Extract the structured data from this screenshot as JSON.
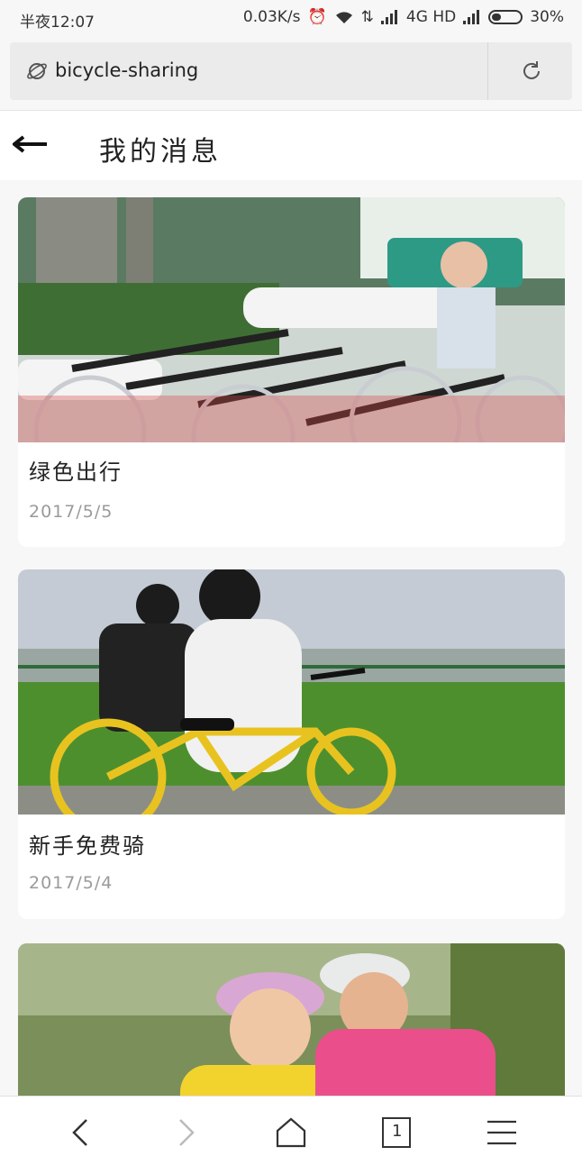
{
  "status_bar": {
    "time": "半夜12:07",
    "network_speed": "0.03K/s",
    "network_type": "4G HD",
    "battery": "30%"
  },
  "browser": {
    "url": "bicycle-sharing"
  },
  "header": {
    "title": "我的消息"
  },
  "messages": [
    {
      "title": "绿色出行",
      "date": "2017/5/5",
      "image": "bike-station-photo"
    },
    {
      "title": "新手免费骑",
      "date": "2017/5/4",
      "image": "couple-riding-photo"
    },
    {
      "title": "",
      "date": "",
      "image": "cyclists-helmet-photo"
    }
  ],
  "bottom_nav": {
    "icons": [
      "back-icon",
      "forward-icon",
      "home-icon",
      "tabs-icon",
      "menu-icon"
    ],
    "tab_count": "1"
  }
}
